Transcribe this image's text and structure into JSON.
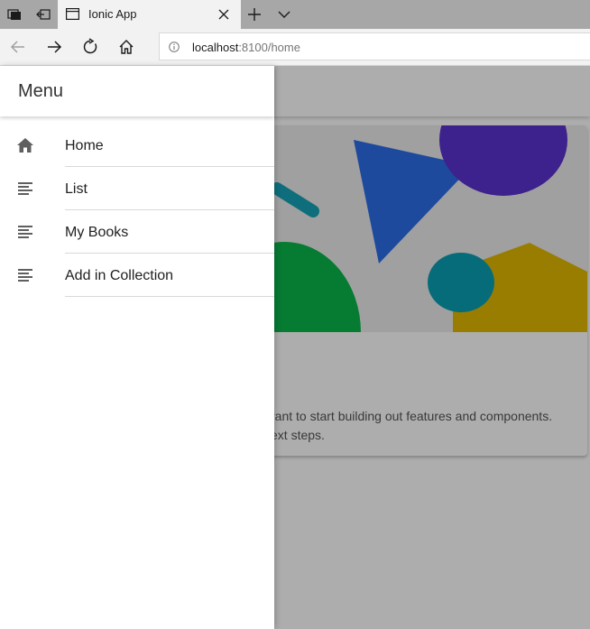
{
  "browser": {
    "tab": {
      "title": "Ionic App"
    },
    "address": {
      "host": "localhost",
      "rest": ":8100/home"
    },
    "icons": [
      "set-aside-tabs-icon",
      "restore-tabs-icon",
      "page-icon",
      "close-icon",
      "new-tab-icon",
      "chevron-down-icon",
      "back-icon",
      "forward-icon",
      "refresh-icon",
      "home-icon",
      "info-icon"
    ]
  },
  "page": {
    "card": {
      "line1": "rant to start building out features and components.",
      "line2": "ext steps."
    },
    "colors": {
      "backdrop": "rgba(0,0,0,0.32)",
      "card_bg": "#ececec"
    }
  },
  "menu": {
    "title": "Menu",
    "items": [
      {
        "label": "Home",
        "icon": "home-icon"
      },
      {
        "label": "List",
        "icon": "list-icon"
      },
      {
        "label": "My Books",
        "icon": "list-icon"
      },
      {
        "label": "Add in Collection",
        "icon": "list-icon"
      }
    ]
  }
}
